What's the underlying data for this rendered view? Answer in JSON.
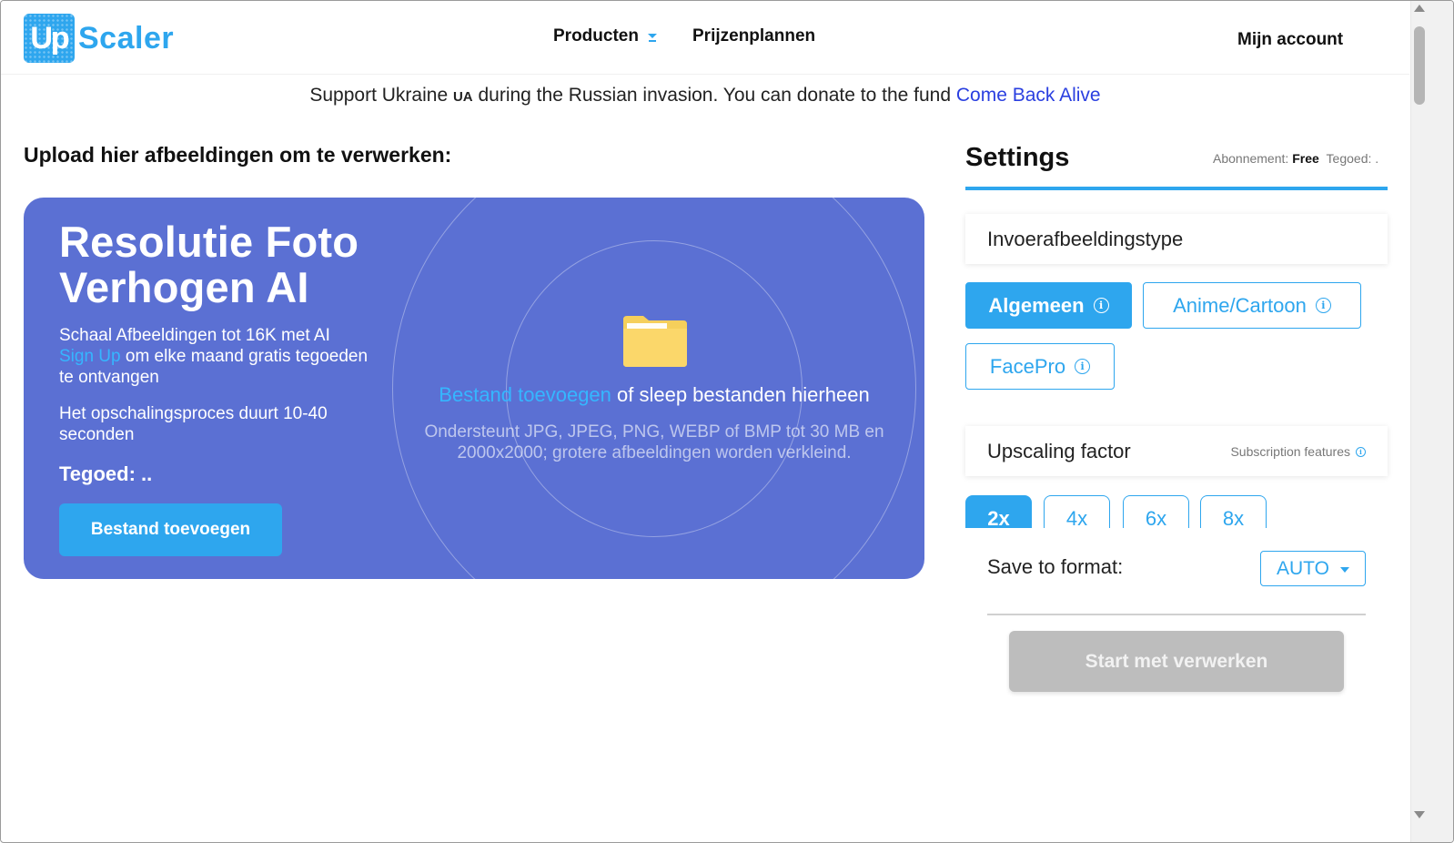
{
  "header": {
    "logo_badge": "Up",
    "logo_text": "Scaler",
    "nav_products": "Producten",
    "nav_pricing": "Prijzenplannen",
    "nav_account": "Mijn account"
  },
  "banner": {
    "text_before": "Support Ukraine ",
    "flag": "UA",
    "text_after": " during the Russian invasion. You can donate to the fund ",
    "link": "Come Back Alive"
  },
  "upload": {
    "title": "Upload hier afbeeldingen om te verwerken:",
    "hero_title_line1": "Resolutie Foto",
    "hero_title_line2": "Verhogen AI",
    "line1": "Schaal Afbeeldingen tot 16K met AI",
    "signup_link": "Sign Up",
    "line2": " om elke maand gratis tegoeden te ontvangen",
    "process_text": "Het opschalingsproces duurt 10-40 seconden",
    "credit_label": "Tegoed:",
    "credit_value": "..",
    "add_button": "Bestand toevoegen",
    "drop_link": "Bestand toevoegen",
    "drop_text": " of sleep bestanden hierheen",
    "drop_sub": "Ondersteunt JPG, JPEG, PNG, WEBP of BMP tot 30 MB en 2000x2000; grotere afbeeldingen worden verkleind.",
    "folder_icon": "folder-icon"
  },
  "settings": {
    "title": "Settings",
    "subscription_label": "Abonnement:",
    "subscription_value": "Free",
    "credit_label": "Tegoed:",
    "credit_value": ".",
    "input_type_title": "Invoerafbeeldingstype",
    "types": [
      "Algemeen",
      "Anime/Cartoon",
      "FacePro"
    ],
    "selected_type": "Algemeen",
    "factor_title": "Upscaling factor",
    "subscription_features": "Subscription features",
    "factors": [
      "2x",
      "4x",
      "6x",
      "8x"
    ],
    "selected_factor": "2x",
    "format_label": "Save to format:",
    "format_value": "AUTO",
    "start_button": "Start met verwerken"
  },
  "colors": {
    "accent": "#2ea6ee",
    "hero_bg": "#5b70d3",
    "link": "#2a3fe0",
    "disabled": "#bdbdbd"
  }
}
